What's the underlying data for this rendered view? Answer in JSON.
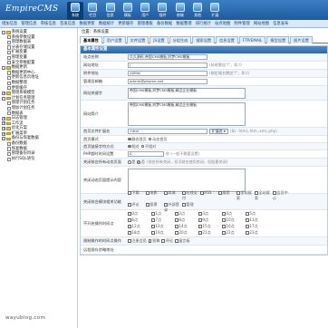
{
  "app": {
    "logo": "EmpireCMS"
  },
  "nav": [
    {
      "label": "系统"
    },
    {
      "label": "栏目"
    },
    {
      "label": "信息"
    },
    {
      "label": "模板"
    },
    {
      "label": "用户"
    },
    {
      "label": "插件"
    },
    {
      "label": "商城"
    },
    {
      "label": "其他"
    },
    {
      "label": "扩展"
    }
  ],
  "subnav": [
    "增加信息",
    "管理信息",
    "审核信息",
    "签发信息",
    "数据更新",
    "数据统计",
    "更新缓存",
    "管理模板",
    "备份数据",
    "数据整理",
    "排行统计",
    "站点地图",
    "附件管理",
    "网站地图",
    "信息发布"
  ],
  "sidebar": {
    "items": [
      {
        "label": "系统设置",
        "level": 0,
        "type": "folder",
        "toggle": "-"
      },
      {
        "label": "系统参数设置",
        "level": 1,
        "type": "doc"
      },
      {
        "label": "管理数据表",
        "level": 1,
        "type": "doc"
      },
      {
        "label": "分表存储设置",
        "level": 1,
        "type": "doc"
      },
      {
        "label": "扩展变量",
        "level": 1,
        "type": "doc"
      },
      {
        "label": "管理变量",
        "level": 1,
        "type": "doc"
      },
      {
        "label": "安全参数配置",
        "level": 1,
        "type": "doc"
      },
      {
        "label": "数据更新",
        "level": 0,
        "type": "folder",
        "toggle": "-"
      },
      {
        "label": "数据更新中心",
        "level": 1,
        "type": "doc"
      },
      {
        "label": "更新信息页地址",
        "level": 1,
        "type": "doc"
      },
      {
        "label": "数据整理",
        "level": 1,
        "type": "doc"
      },
      {
        "label": "更新缓存",
        "level": 1,
        "type": "doc"
      },
      {
        "label": "管理系统模型",
        "level": 0,
        "type": "folder",
        "toggle": "+"
      },
      {
        "label": "计划任务管理",
        "level": 0,
        "type": "folder",
        "toggle": "-"
      },
      {
        "label": "管理计划任务",
        "level": 1,
        "type": "doc"
      },
      {
        "label": "增加计划任务",
        "level": 1,
        "type": "doc"
      },
      {
        "label": "数据表",
        "level": 1,
        "type": "doc"
      },
      {
        "label": "日志管理",
        "level": 0,
        "type": "folder",
        "toggle": "+"
      },
      {
        "label": "工作流",
        "level": 0,
        "type": "folder",
        "toggle": "+"
      },
      {
        "label": "优化方案",
        "level": 0,
        "type": "folder",
        "toggle": "+"
      },
      {
        "label": "扩展菜单",
        "level": 0,
        "type": "folder",
        "toggle": "+"
      },
      {
        "label": "备份与恢复数据",
        "level": 0,
        "type": "folder",
        "toggle": "-"
      },
      {
        "label": "备份数据",
        "level": 1,
        "type": "doc"
      },
      {
        "label": "恢复数据",
        "level": 1,
        "type": "doc"
      },
      {
        "label": "管理备份目录",
        "level": 1,
        "type": "doc"
      },
      {
        "label": "执行SQL语句",
        "level": 1,
        "type": "doc"
      }
    ],
    "watermark": "wayublog.com"
  },
  "main": {
    "breadcrumb": "位置：系统设置",
    "tabs": [
      "基本属性",
      "用户设置",
      "文件设置",
      "JS设置",
      "分组生成",
      "搜索设置",
      "信息设置",
      "FTP/EMAIL",
      "模型设置",
      "图片设置"
    ],
    "form_title": "基本属性设置",
    "fields": {
      "site_name": {
        "label": "站点名称",
        "value": "久久源码-帝国CMS模板,织梦CMS模板"
      },
      "site_url": {
        "label": "网站地址",
        "value": "/",
        "hint": "(结尾需加\"/\"，如:/)"
      },
      "attach_url": {
        "label": "附件地址",
        "value": "/d/file/",
        "hint": "(绑定域名需加\"/\"，如:/)"
      },
      "admin_email": {
        "label": "管理员邮箱",
        "value": "admin@phome.net"
      },
      "keywords": {
        "label": "网站关键字",
        "value": "帝国CMS模板,织梦CMS模板,精品企业模板"
      },
      "description": {
        "label": "网站简介",
        "value": "帝国CMS模板,织梦CMS模板,精品企业模板"
      },
      "index_ext": {
        "label": "首页文件扩展名",
        "value": ".html",
        "select": "扩展名",
        "hint": "(如: .html,.htm,.xml,.php)"
      },
      "index_mode": {
        "label": "首页模式",
        "options": [
          "静态首页",
          "动态首页"
        ],
        "selected": 0
      },
      "index_nav": {
        "label": "首页链接字符方式",
        "options": [
          "相对",
          "不相对"
        ],
        "selected": 0
      },
      "php_timeout": {
        "label": "PHP超时时间设置",
        "value": "0",
        "hint": "秒 (一般不需要设置)"
      },
      "close_site": {
        "label": "关闭前台所有动态页面",
        "options": [
          "是",
          "否"
        ],
        "selected": 1,
        "hint": "(前台所有关闭，但可前台使用关闭，但批量关闭)"
      },
      "close_reason": {
        "label": "关闭动态页面提示内容"
      },
      "close_modules": {
        "label": "关闭前台模块相关功能",
        "items": [
          "下载",
          "电影",
          "商城",
          "在线支付",
          "RSS",
          "搜索",
          "全站搜索",
          "全站搜索",
          "会员中心",
          "评论",
          "投票",
          "外部登录",
          "管理"
        ]
      },
      "page_sort": {
        "label": "不开启操作时间点",
        "items": [
          "0点",
          "1点",
          "2点",
          "3点",
          "4点",
          "5点",
          "6点",
          "7点",
          "8点",
          "9点",
          "10点",
          "11点",
          "12点",
          "13点",
          "14点",
          "15点",
          "16点",
          "17点",
          "18点",
          "19点",
          "20点",
          "21点",
          "22点",
          "23点"
        ]
      },
      "time_ops": {
        "label": "限制操作的时间点操作",
        "items": [
          "注册会员",
          "投稿",
          "评论",
          "留言板"
        ]
      },
      "spider": {
        "label": "远程保存忽略地址"
      }
    }
  }
}
